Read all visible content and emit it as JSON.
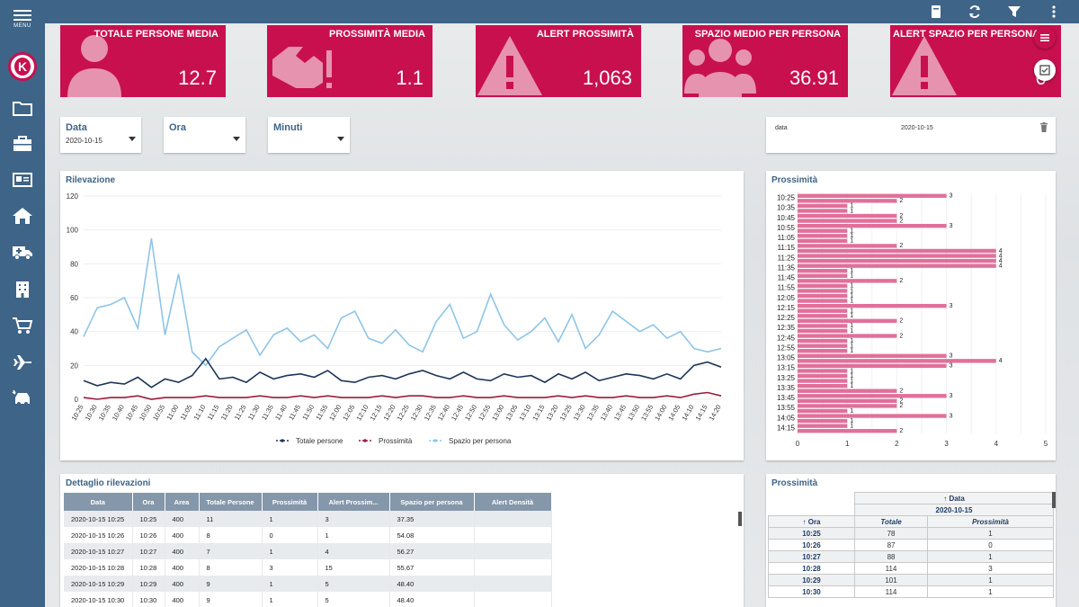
{
  "sidebar": {
    "menu_label": "MENU",
    "logo_letter": "K"
  },
  "kpis": [
    {
      "title": "TOTALE PERSONE MEDIA",
      "value": "12.7",
      "icon": "person-icon"
    },
    {
      "title": "PROSSIMITÀ MEDIA",
      "value": "1.1",
      "icon": "handshake-alert-icon"
    },
    {
      "title": "ALERT PROSSIMITÀ",
      "value": "1,063",
      "icon": "warning-icon"
    },
    {
      "title": "SPAZIO MEDIO PER PERSONA",
      "value": "36.91",
      "icon": "group-icon"
    },
    {
      "title": "ALERT SPAZIO PER PERSONA",
      "value": "0",
      "icon": "warning-icon"
    }
  ],
  "filters": {
    "data": {
      "label": "Data",
      "value": "2020-10-15"
    },
    "ora": {
      "label": "Ora",
      "value": ""
    },
    "minuti": {
      "label": "Minuti",
      "value": ""
    }
  },
  "datebar": {
    "label": "data",
    "value": "2020-10-15"
  },
  "line_panel": {
    "title": "Rilevazione",
    "legend": [
      "Totale persone",
      "Prossimità",
      "Spazio per persona"
    ]
  },
  "colors": {
    "sidebar": "#3e6487",
    "kpi": "#c8104f",
    "bar": "#e0709a",
    "line1": "#1d3557",
    "line2": "#9b1b3d",
    "line3": "#8ec5e8"
  },
  "chart_data": [
    {
      "type": "line",
      "title": "Rilevazione",
      "xlabel": "",
      "ylabel": "",
      "ylim": [
        0,
        120
      ],
      "yticks": [
        0,
        20,
        40,
        60,
        80,
        100,
        120
      ],
      "categories": [
        "10:25",
        "10:30",
        "10:35",
        "10:40",
        "10:45",
        "10:50",
        "10:55",
        "11:00",
        "11:05",
        "11:10",
        "11:15",
        "11:20",
        "11:25",
        "11:30",
        "11:35",
        "11:40",
        "11:45",
        "11:50",
        "11:55",
        "12:00",
        "12:05",
        "12:10",
        "12:15",
        "12:20",
        "12:25",
        "12:30",
        "12:35",
        "12:40",
        "12:45",
        "12:50",
        "12:55",
        "13:00",
        "13:05",
        "13:10",
        "13:15",
        "13:20",
        "13:25",
        "13:30",
        "13:35",
        "13:40",
        "13:45",
        "13:50",
        "13:55",
        "14:00",
        "14:05",
        "14:10",
        "14:15",
        "14:20"
      ],
      "series": [
        {
          "name": "Totale persone",
          "values": [
            11,
            8,
            10,
            9,
            13,
            7,
            12,
            10,
            14,
            24,
            12,
            13,
            10,
            16,
            12,
            14,
            15,
            13,
            17,
            11,
            10,
            13,
            14,
            12,
            15,
            17,
            14,
            12,
            16,
            12,
            11,
            15,
            13,
            14,
            10,
            15,
            12,
            16,
            11,
            13,
            15,
            14,
            12,
            15,
            12,
            20,
            22,
            19
          ]
        },
        {
          "name": "Prossimità",
          "values": [
            1,
            0,
            1,
            1,
            2,
            0,
            1,
            1,
            1,
            2,
            1,
            1,
            1,
            2,
            1,
            1,
            2,
            1,
            2,
            1,
            1,
            1,
            2,
            1,
            2,
            2,
            1,
            1,
            2,
            1,
            1,
            2,
            1,
            1,
            1,
            2,
            1,
            2,
            1,
            1,
            2,
            1,
            1,
            2,
            1,
            3,
            4,
            2
          ]
        },
        {
          "name": "Spazio per persona",
          "values": [
            37,
            54,
            56,
            60,
            42,
            95,
            38,
            74,
            28,
            20,
            31,
            36,
            41,
            26,
            38,
            42,
            34,
            38,
            30,
            48,
            52,
            36,
            33,
            41,
            32,
            28,
            46,
            56,
            36,
            40,
            62,
            44,
            35,
            40,
            48,
            34,
            50,
            30,
            38,
            52,
            46,
            40,
            44,
            36,
            40,
            30,
            28,
            30
          ]
        }
      ]
    },
    {
      "type": "bar",
      "orientation": "horizontal",
      "title": "Prossimità",
      "xlim": [
        0,
        5
      ],
      "xticks": [
        0,
        0.5,
        1,
        1.5,
        2,
        2.5,
        3,
        3.5,
        4,
        4.5,
        5
      ],
      "categories": [
        "10:25",
        "10:30",
        "10:35",
        "10:40",
        "10:45",
        "10:50",
        "10:55",
        "11:00",
        "11:05",
        "11:10",
        "11:15",
        "11:20",
        "11:25",
        "11:30",
        "11:35",
        "11:40",
        "11:45",
        "11:50",
        "11:55",
        "12:00",
        "12:05",
        "12:10",
        "12:15",
        "12:20",
        "12:25",
        "12:30",
        "12:35",
        "12:40",
        "12:45",
        "12:50",
        "12:55",
        "13:00",
        "13:05",
        "13:10",
        "13:15",
        "13:20",
        "13:25",
        "13:30",
        "13:35",
        "13:40",
        "13:45",
        "13:50",
        "13:55",
        "14:00",
        "14:05",
        "14:10",
        "14:15",
        "14:20"
      ],
      "values": [
        3,
        2,
        1,
        1,
        2,
        2,
        3,
        1,
        1,
        1,
        2,
        4,
        4,
        4,
        4,
        1,
        1,
        2,
        1,
        1,
        1,
        1,
        3,
        1,
        1,
        2,
        1,
        1,
        2,
        1,
        1,
        1,
        3,
        4,
        3,
        1,
        1,
        1,
        1,
        2,
        3,
        2,
        2,
        1,
        3,
        1,
        1,
        2
      ]
    }
  ],
  "detail": {
    "title": "Dettaglio rilevazioni",
    "columns": [
      "Data",
      "Ora",
      "Area",
      "Totale Persone",
      "Prossimità",
      "Alert Prossim...",
      "Spazio per persona",
      "Alert Densità"
    ],
    "rows": [
      [
        "2020-10-15 10:25",
        "10:25",
        "400",
        "11",
        "1",
        "3",
        "37.35",
        ""
      ],
      [
        "2020-10-15 10:26",
        "10:26",
        "400",
        "8",
        "0",
        "1",
        "54.08",
        ""
      ],
      [
        "2020-10-15 10:27",
        "10:27",
        "400",
        "7",
        "1",
        "4",
        "56.27",
        ""
      ],
      [
        "2020-10-15 10:28",
        "10:28",
        "400",
        "8",
        "3",
        "15",
        "55.67",
        ""
      ],
      [
        "2020-10-15 10:29",
        "10:29",
        "400",
        "9",
        "1",
        "5",
        "48.40",
        ""
      ],
      [
        "2020-10-15 10:30",
        "10:30",
        "400",
        "9",
        "1",
        "5",
        "48.40",
        ""
      ]
    ]
  },
  "pivot": {
    "title": "Prossimità",
    "col_header": "Data",
    "date": "2020-10-15",
    "row_header": "Ora",
    "measures": [
      "Totale",
      "Prossimità"
    ],
    "rows": [
      [
        "10:25",
        "78",
        "1"
      ],
      [
        "10:26",
        "87",
        "0"
      ],
      [
        "10:27",
        "88",
        "1"
      ],
      [
        "10:28",
        "114",
        "3"
      ],
      [
        "10:29",
        "101",
        "1"
      ],
      [
        "10:30",
        "114",
        "1"
      ]
    ]
  }
}
